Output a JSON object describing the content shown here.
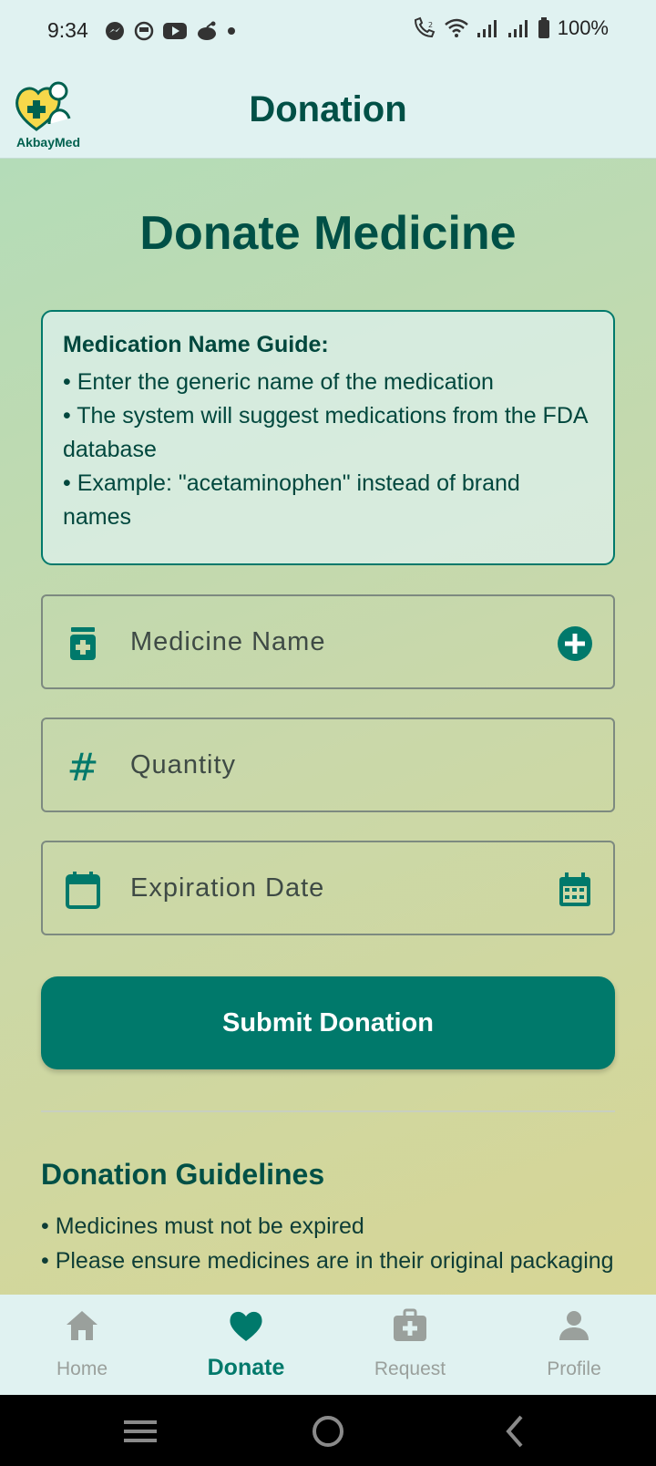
{
  "status_bar": {
    "time": "9:34",
    "battery": "100%"
  },
  "app_bar": {
    "title": "Donation",
    "logo_text": "AkbayMed"
  },
  "page": {
    "heading": "Donate Medicine"
  },
  "guide": {
    "title": "Medication Name Guide:",
    "lines": [
      "• Enter the generic name of the medication",
      "• The system will suggest medications from the FDA database",
      "• Example: \"acetaminophen\" instead of brand names"
    ]
  },
  "form": {
    "medicine_placeholder": "Medicine Name",
    "quantity_placeholder": "Quantity",
    "expiration_placeholder": "Expiration Date",
    "submit_label": "Submit Donation"
  },
  "guidelines": {
    "title": "Donation Guidelines",
    "items": [
      "• Medicines must not be expired",
      "• Please ensure medicines are in their original packaging"
    ]
  },
  "nav": {
    "items": [
      {
        "label": "Home",
        "icon": "home-icon"
      },
      {
        "label": "Donate",
        "icon": "heart-icon"
      },
      {
        "label": "Request",
        "icon": "medical-bag-icon"
      },
      {
        "label": "Profile",
        "icon": "person-icon"
      }
    ],
    "active": "Donate"
  },
  "colors": {
    "primary": "#00796b",
    "heading": "#005046",
    "background": "#e0f2f1",
    "inactive_nav": "#9aa09c"
  }
}
